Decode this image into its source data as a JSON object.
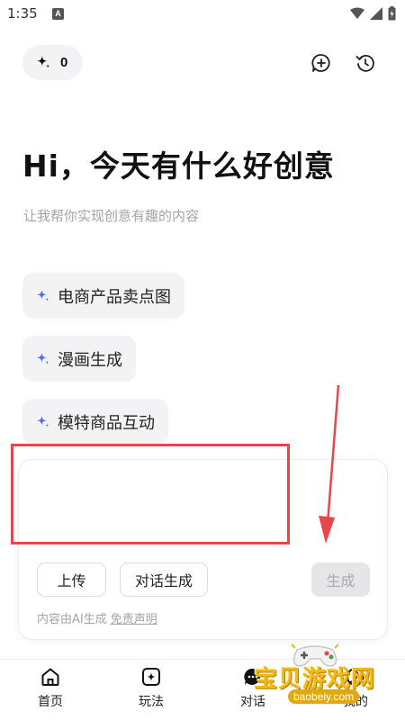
{
  "status_bar": {
    "time": "1:35",
    "notification_badge": "A"
  },
  "header": {
    "credits_value": "0",
    "icons": [
      "sparkle-icon",
      "new-chat-icon",
      "history-icon"
    ]
  },
  "hero": {
    "greeting": "Hi，今天有什么好创意",
    "subtitle": "让我帮你实现创意有趣的内容"
  },
  "suggestions": [
    {
      "label": "电商产品卖点图"
    },
    {
      "label": "漫画生成"
    },
    {
      "label": "模特商品互动"
    }
  ],
  "composer": {
    "input_value": "",
    "upload_label": "上传",
    "dialog_generate_label": "对话生成",
    "generate_label": "生成",
    "disclaimer_prefix": "内容由AI生成",
    "disclaimer_link": "免责声明"
  },
  "bottom_nav": {
    "items": [
      {
        "label": "首页",
        "icon": "home-icon"
      },
      {
        "label": "玩法",
        "icon": "play-icon"
      },
      {
        "label": "对话",
        "icon": "chat-icon"
      },
      {
        "label": "我的",
        "icon": "profile-icon"
      }
    ]
  },
  "watermark": {
    "text": "宝贝游戏网",
    "url": "baobeiy.com"
  },
  "colors": {
    "accent": "#4f6ef7",
    "annotation_red": "#e8464b",
    "chip_bg": "#f3f3f5",
    "muted_text": "#a4a4a8",
    "watermark_gold": "#f2b816"
  }
}
